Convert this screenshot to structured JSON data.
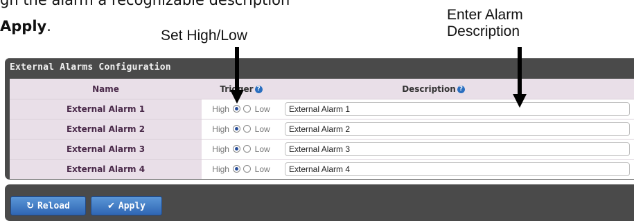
{
  "instructions": {
    "line1": "gn the alarm a recognizable description",
    "line2_bold": "Apply",
    "line2_suffix": "."
  },
  "callouts": {
    "set_high_low": "Set High/Low",
    "enter_desc_line1": "Enter Alarm",
    "enter_desc_line2": "Description"
  },
  "panel": {
    "title": "External Alarms Configuration",
    "columns": {
      "name": "Name",
      "trigger": "Trigger",
      "description": "Description",
      "help_icon": "question-circle-icon"
    },
    "rows": [
      {
        "name": "External Alarm 1",
        "high_label": "High",
        "low_label": "Low",
        "trigger": "High",
        "description": "External Alarm 1"
      },
      {
        "name": "External Alarm 2",
        "high_label": "High",
        "low_label": "Low",
        "trigger": "High",
        "description": "External Alarm 2"
      },
      {
        "name": "External Alarm 3",
        "high_label": "High",
        "low_label": "Low",
        "trigger": "High",
        "description": "External Alarm 3"
      },
      {
        "name": "External Alarm 4",
        "high_label": "High",
        "low_label": "Low",
        "trigger": "High",
        "description": "External Alarm 4"
      }
    ]
  },
  "buttons": {
    "reload_label": "Reload",
    "reload_icon": "refresh-icon",
    "apply_label": "Apply",
    "apply_icon": "checkmark-icon"
  },
  "colors": {
    "panel_bg": "#4a4a4a",
    "header_bg": "#e9dfe8",
    "button_blue": "#2f66b3",
    "radio_selected": "#2a4f9a"
  }
}
